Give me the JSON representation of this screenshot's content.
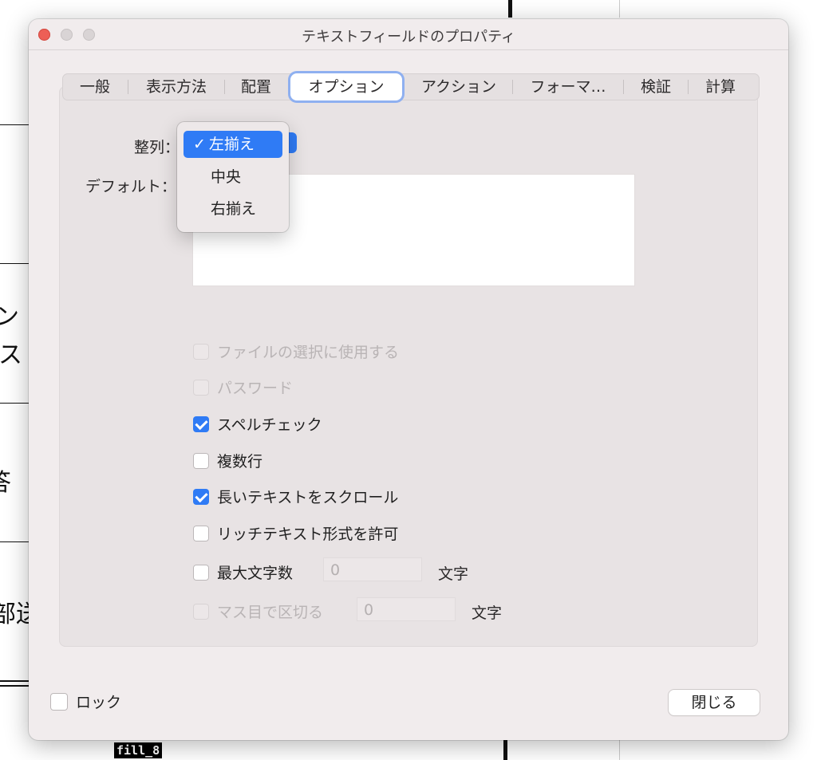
{
  "background": {
    "fragments": [
      "ン",
      "ス",
      "答",
      "部送"
    ],
    "field_tag": "fill_8"
  },
  "window": {
    "title": "テキストフィールドのプロパティ"
  },
  "tabs": [
    {
      "label": "一般"
    },
    {
      "label": "表示方法"
    },
    {
      "label": "配置"
    },
    {
      "label": "オプション",
      "active": true
    },
    {
      "label": "アクション"
    },
    {
      "label": "フォーマ…"
    },
    {
      "label": "検証"
    },
    {
      "label": "計算"
    }
  ],
  "options": {
    "alignment_label": "整列：",
    "default_label": "デフォルト：",
    "alignment_menu": {
      "items": [
        "左揃え",
        "中央",
        "右揃え"
      ],
      "selected": "左揃え",
      "check": "✓"
    },
    "default_value": "",
    "checkboxes": {
      "file_select": {
        "label": "ファイルの選択に使用する",
        "checked": false,
        "enabled": false
      },
      "password": {
        "label": "パスワード",
        "checked": false,
        "enabled": false
      },
      "spell_check": {
        "label": "スペルチェック",
        "checked": true,
        "enabled": true
      },
      "multiline": {
        "label": "複数行",
        "checked": false,
        "enabled": true
      },
      "scroll_long_text": {
        "label": "長いテキストをスクロール",
        "checked": true,
        "enabled": true
      },
      "rich_text": {
        "label": "リッチテキスト形式を許可",
        "checked": false,
        "enabled": true
      },
      "max_chars": {
        "label": "最大文字数",
        "checked": false,
        "enabled": true,
        "value": "0",
        "unit": "文字"
      },
      "comb": {
        "label": "マス目で区切る",
        "checked": false,
        "enabled": false,
        "value": "0",
        "unit": "文字"
      }
    }
  },
  "footer": {
    "lock_label": "ロック",
    "close_label": "閉じる"
  },
  "colors": {
    "accent": "#2f7bf5",
    "close_button": "#ed5f56",
    "window_bg": "#f1eced"
  }
}
